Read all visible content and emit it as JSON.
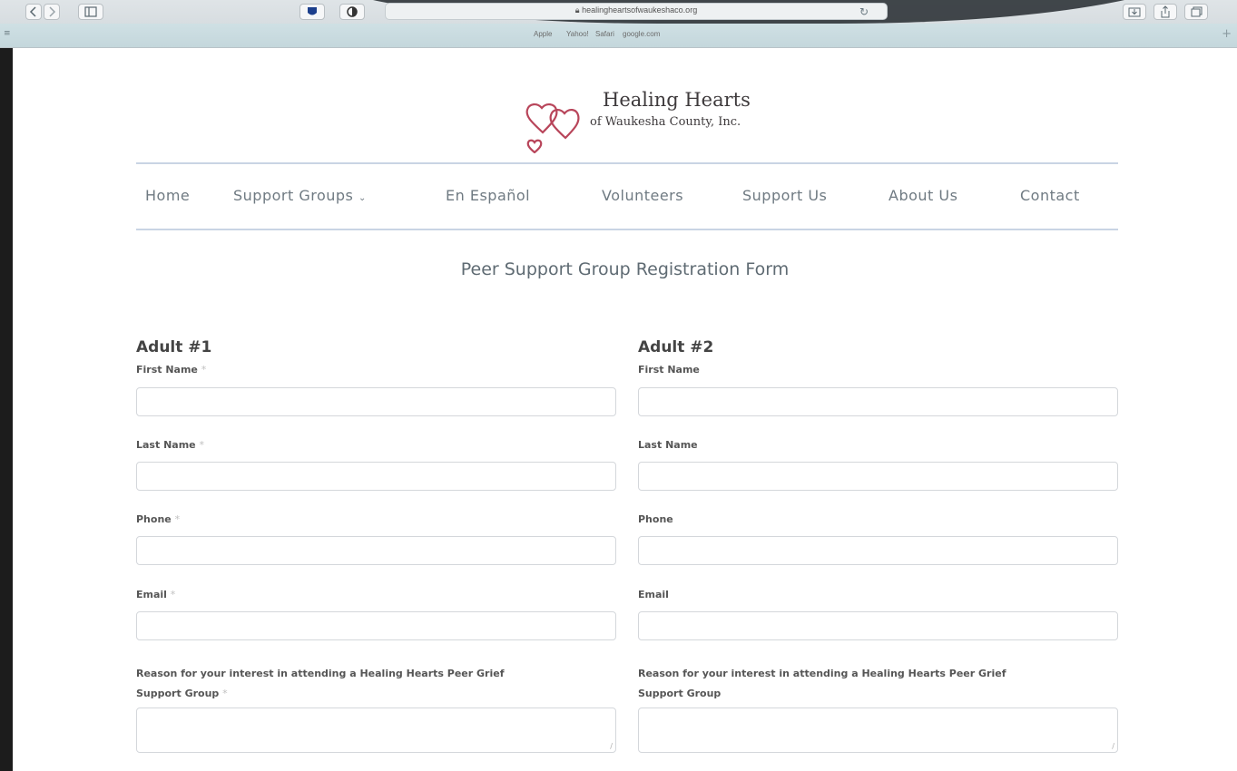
{
  "browser": {
    "url": "healingheartsofwaukeshaco.org",
    "favorites": [
      "Apple",
      "Yahoo!",
      "Safari",
      "google.com"
    ]
  },
  "site": {
    "logo_line1": "Healing Hearts",
    "logo_line2": "of Waukesha County, Inc."
  },
  "nav": {
    "items": [
      "Home",
      "Support Groups",
      "En Español",
      "Volunteers",
      "Support Us",
      "About Us",
      "Contact"
    ]
  },
  "form": {
    "title": "Peer Support Group Registration Form",
    "adult1": {
      "heading": "Adult #1",
      "first_name": "First Name",
      "last_name": "Last Name",
      "phone": "Phone",
      "email": "Email",
      "reason_line1": "Reason for your interest in attending a Healing Hearts Peer Grief",
      "reason_line2": "Support Group",
      "required_mark": "*"
    },
    "adult2": {
      "heading": "Adult #2",
      "first_name": "First Name",
      "last_name": "Last Name",
      "phone": "Phone",
      "email": "Email",
      "reason_line1": "Reason for your interest in attending a Healing Hearts Peer Grief",
      "reason_line2": "Support Group"
    }
  },
  "colors": {
    "accent_line": "#c9d4e4",
    "heart": "#b8455a"
  }
}
